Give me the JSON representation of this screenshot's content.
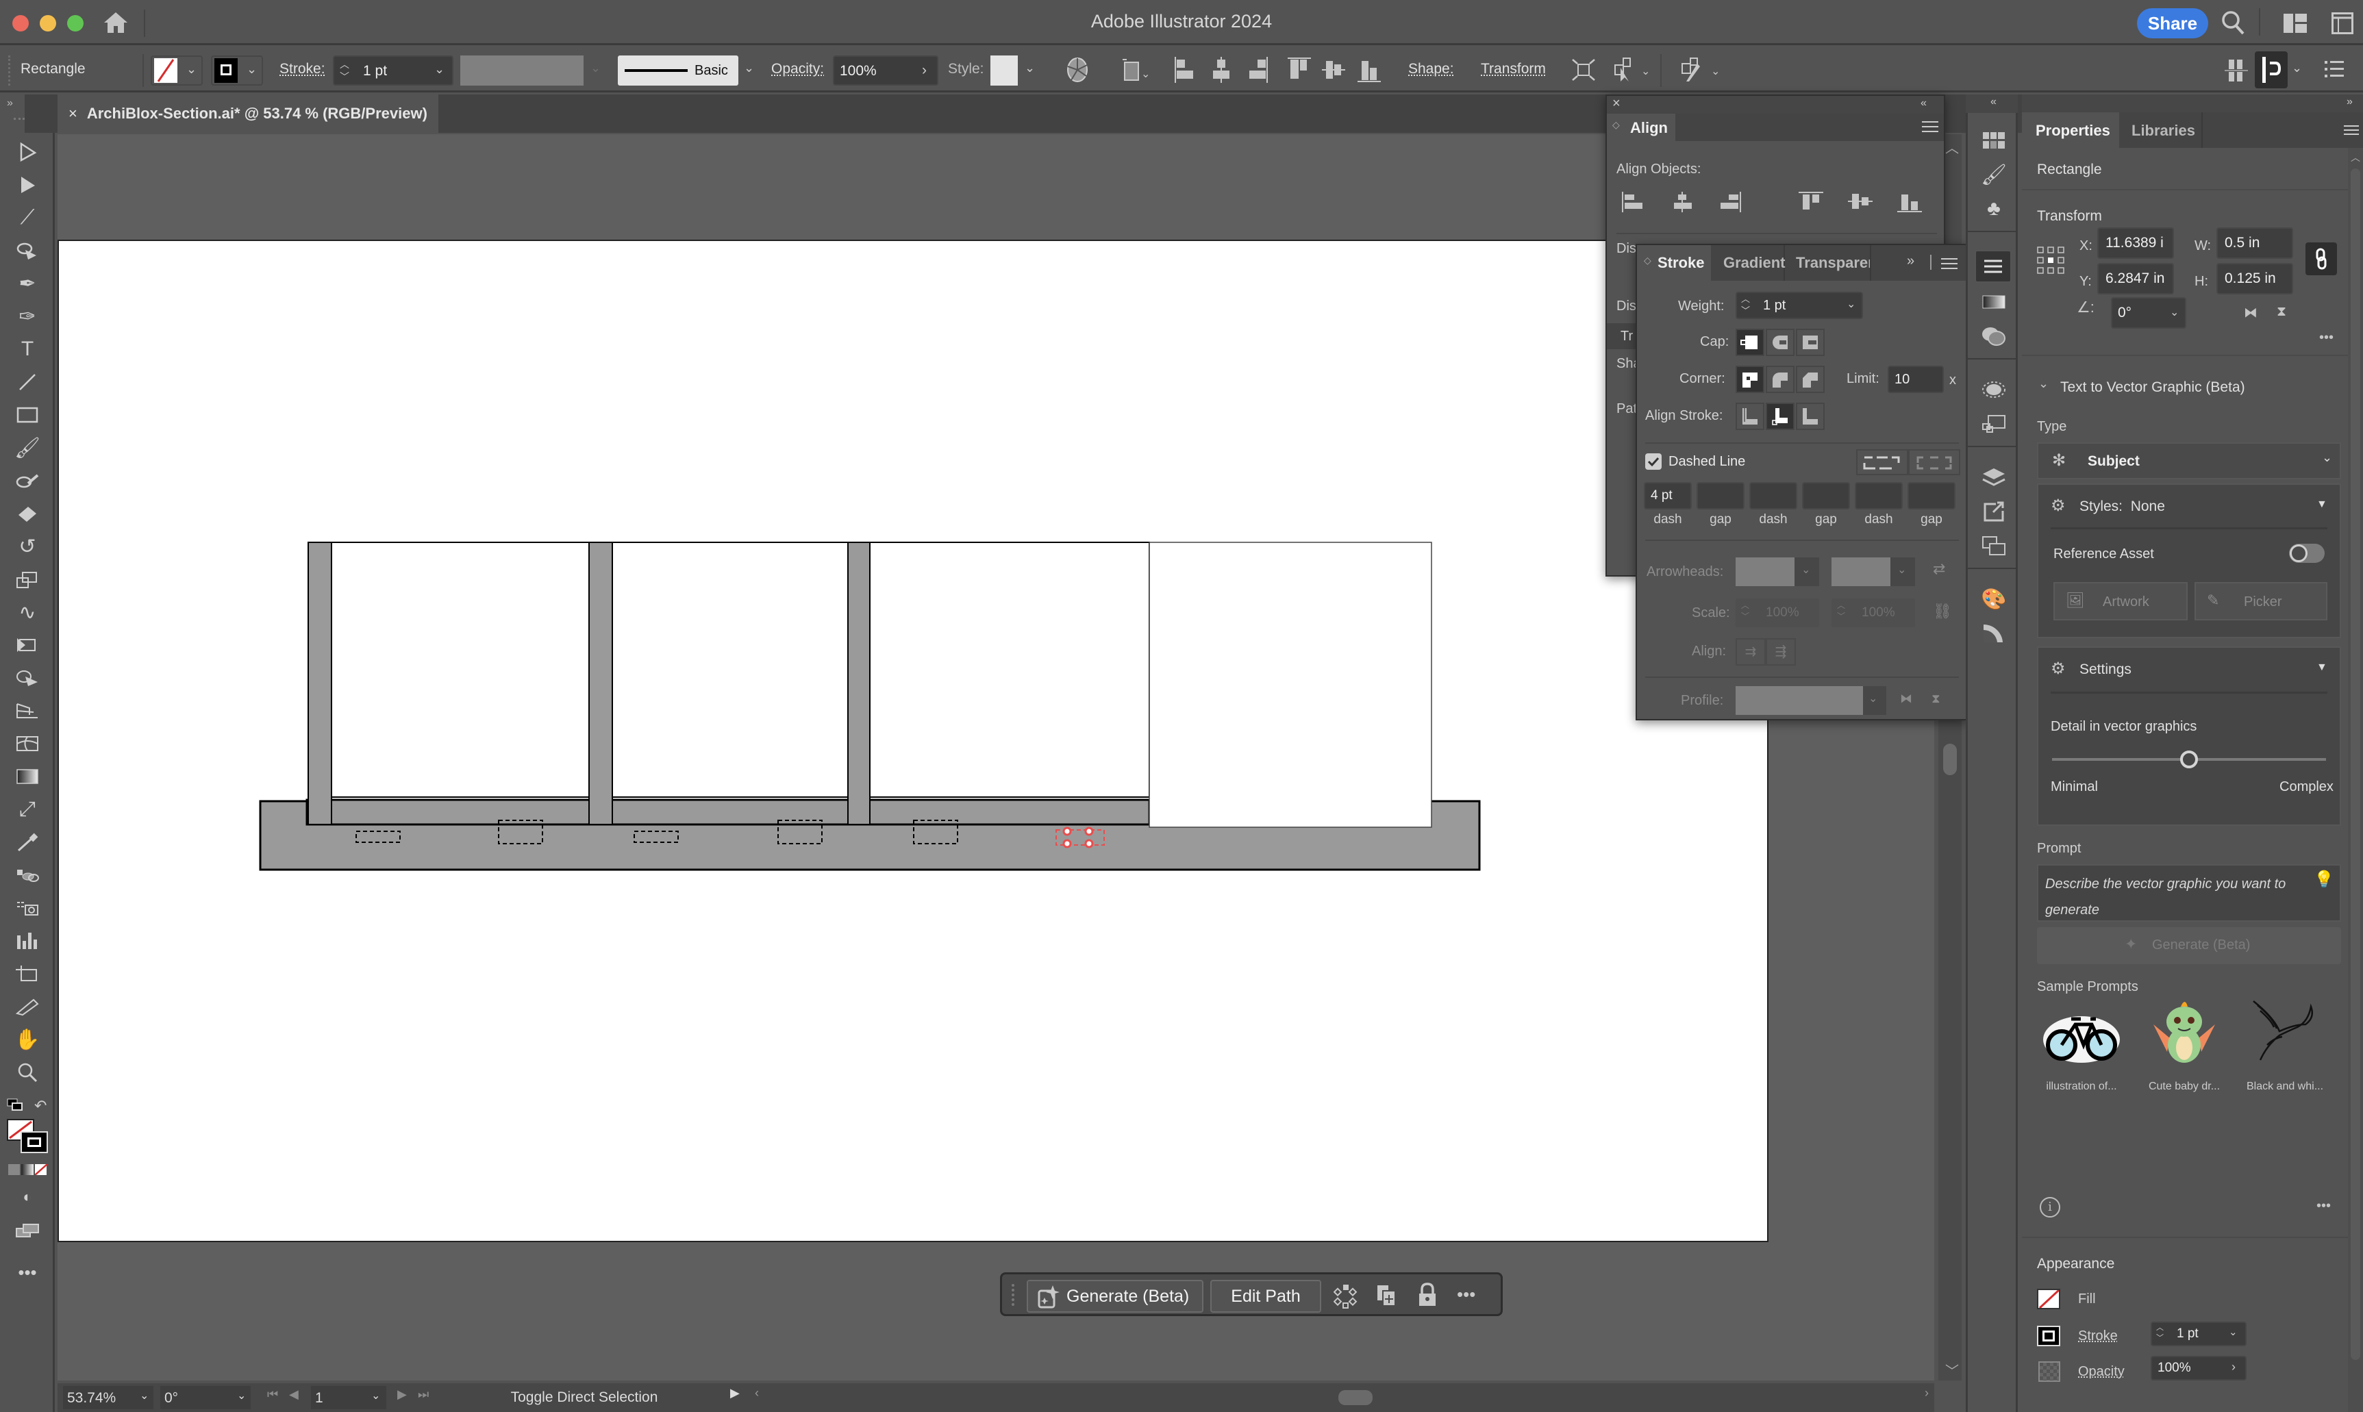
{
  "window": {
    "app_title": "Adobe Illustrator 2024",
    "share_label": "Share",
    "traffic_colors": {
      "close": "#ec6a5e",
      "minimize": "#f4be4f",
      "maximize": "#61c554"
    }
  },
  "control_bar": {
    "object_type": "Rectangle",
    "stroke_label": "Stroke:",
    "stroke_weight": "1 pt",
    "brush_label": "Basic",
    "opacity_label": "Opacity:",
    "opacity_value": "100%",
    "style_label": "Style:",
    "shape_label": "Shape:",
    "transform_label": "Transform"
  },
  "document": {
    "tab_title": "ArchiBlox-Section.ai* @ 53.74 % (RGB/Preview)",
    "close_glyph": "×"
  },
  "align_panel": {
    "title": "Align",
    "align_objects_label": "Align Objects:",
    "clipped_labels": [
      "Dis",
      "Dis",
      "Tr",
      "Sha",
      "Pat"
    ]
  },
  "stroke_panel": {
    "tabs": [
      "Stroke",
      "Gradient",
      "Transparer"
    ],
    "weight_label": "Weight:",
    "weight_value": "1 pt",
    "cap_label": "Cap:",
    "corner_label": "Corner:",
    "limit_label": "Limit:",
    "limit_value": "10",
    "limit_suffix": "x",
    "align_stroke_label": "Align Stroke:",
    "dashed_line_label": "Dashed Line",
    "dashed_line_checked": true,
    "dash_fields": [
      {
        "value": "4 pt",
        "label": "dash"
      },
      {
        "value": "",
        "label": "gap"
      },
      {
        "value": "",
        "label": "dash"
      },
      {
        "value": "",
        "label": "gap"
      },
      {
        "value": "",
        "label": "dash"
      },
      {
        "value": "",
        "label": "gap"
      }
    ],
    "arrowheads_label": "Arrowheads:",
    "scale_label": "Scale:",
    "scale_start": "100%",
    "scale_end": "100%",
    "align_label": "Align:",
    "profile_label": "Profile:"
  },
  "properties": {
    "tabs": [
      "Properties",
      "Libraries"
    ],
    "object_type": "Rectangle",
    "transform_title": "Transform",
    "x_label": "X:",
    "x_value": "11.6389 i",
    "y_label": "Y:",
    "y_value": "6.2847 in",
    "w_label": "W:",
    "w_value": "0.5 in",
    "h_label": "H:",
    "h_value": "0.125 in",
    "angle_value": "0°",
    "t2v_title": "Text to Vector Graphic (Beta)",
    "type_label": "Type",
    "type_value": "Subject",
    "styles_label": "Styles:",
    "styles_value": "None",
    "reference_asset_label": "Reference Asset",
    "reference_asset_on": false,
    "artwork_label": "Artwork",
    "picker_label": "Picker",
    "settings_label": "Settings",
    "detail_label": "Detail in vector graphics",
    "detail_min_label": "Minimal",
    "detail_max_label": "Complex",
    "detail_value": 0.5,
    "prompt_label": "Prompt",
    "prompt_placeholder": "Describe the vector graphic you want to generate",
    "generate_label": "Generate (Beta)",
    "sample_prompts_label": "Sample Prompts",
    "samples": [
      {
        "caption": "illustration of..."
      },
      {
        "caption": "Cute baby dr..."
      },
      {
        "caption": "Black and whi..."
      }
    ],
    "appearance_title": "Appearance",
    "fill_label": "Fill",
    "stroke_label": "Stroke",
    "stroke_value": "1 pt",
    "opacity_label": "Opacity",
    "opacity_value": "100%"
  },
  "taskbar": {
    "generate_label": "Generate (Beta)",
    "edit_path_label": "Edit Path"
  },
  "status_bar": {
    "zoom": "53.74%",
    "rotation": "0°",
    "artboard_number": "1",
    "tool_hint": "Toggle Direct Selection"
  }
}
